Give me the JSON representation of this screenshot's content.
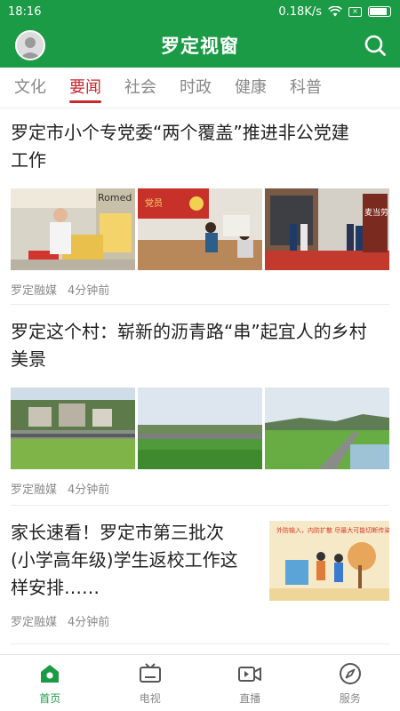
{
  "status_bar": {
    "time": "18:16",
    "net_speed": "0.18K/s",
    "battery_level": 0.85
  },
  "header": {
    "title": "罗定视窗"
  },
  "tabs": [
    "文化",
    "要闻",
    "社会",
    "时政",
    "健康",
    "科普"
  ],
  "active_tab": 1,
  "articles": [
    {
      "title_line1": "罗定市小个专党委“两个覆盖”推进非公党建",
      "title_line2": "工作",
      "image_sign": "Romed",
      "image_sign2": "党员",
      "image_sign3": "麦当劳",
      "source": "罗定融媒",
      "time": "4分钟前"
    },
    {
      "title_line1": "罗定这个村：崭新的沥青路“串”起宜人的乡村",
      "title_line2": "美景",
      "source": "罗定融媒",
      "time": "4分钟前"
    },
    {
      "title_line1": "家长速看！罗定市第三批次",
      "title_line2": "(小学高年级)学生返校工作这",
      "title_line3": "样安排……",
      "image_caption": "外防输入，内防扩散 尽最大可能切断传染源",
      "source": "罗定融媒",
      "time": "4分钟前"
    }
  ],
  "bottom_nav": [
    {
      "label": "首页",
      "icon": "home-icon"
    },
    {
      "label": "电视",
      "icon": "tv-icon"
    },
    {
      "label": "直播",
      "icon": "live-video-icon"
    },
    {
      "label": "服务",
      "icon": "compass-icon"
    }
  ],
  "colors": {
    "brand_green": "#1c9b46",
    "active_tab_red": "#c8282e"
  }
}
